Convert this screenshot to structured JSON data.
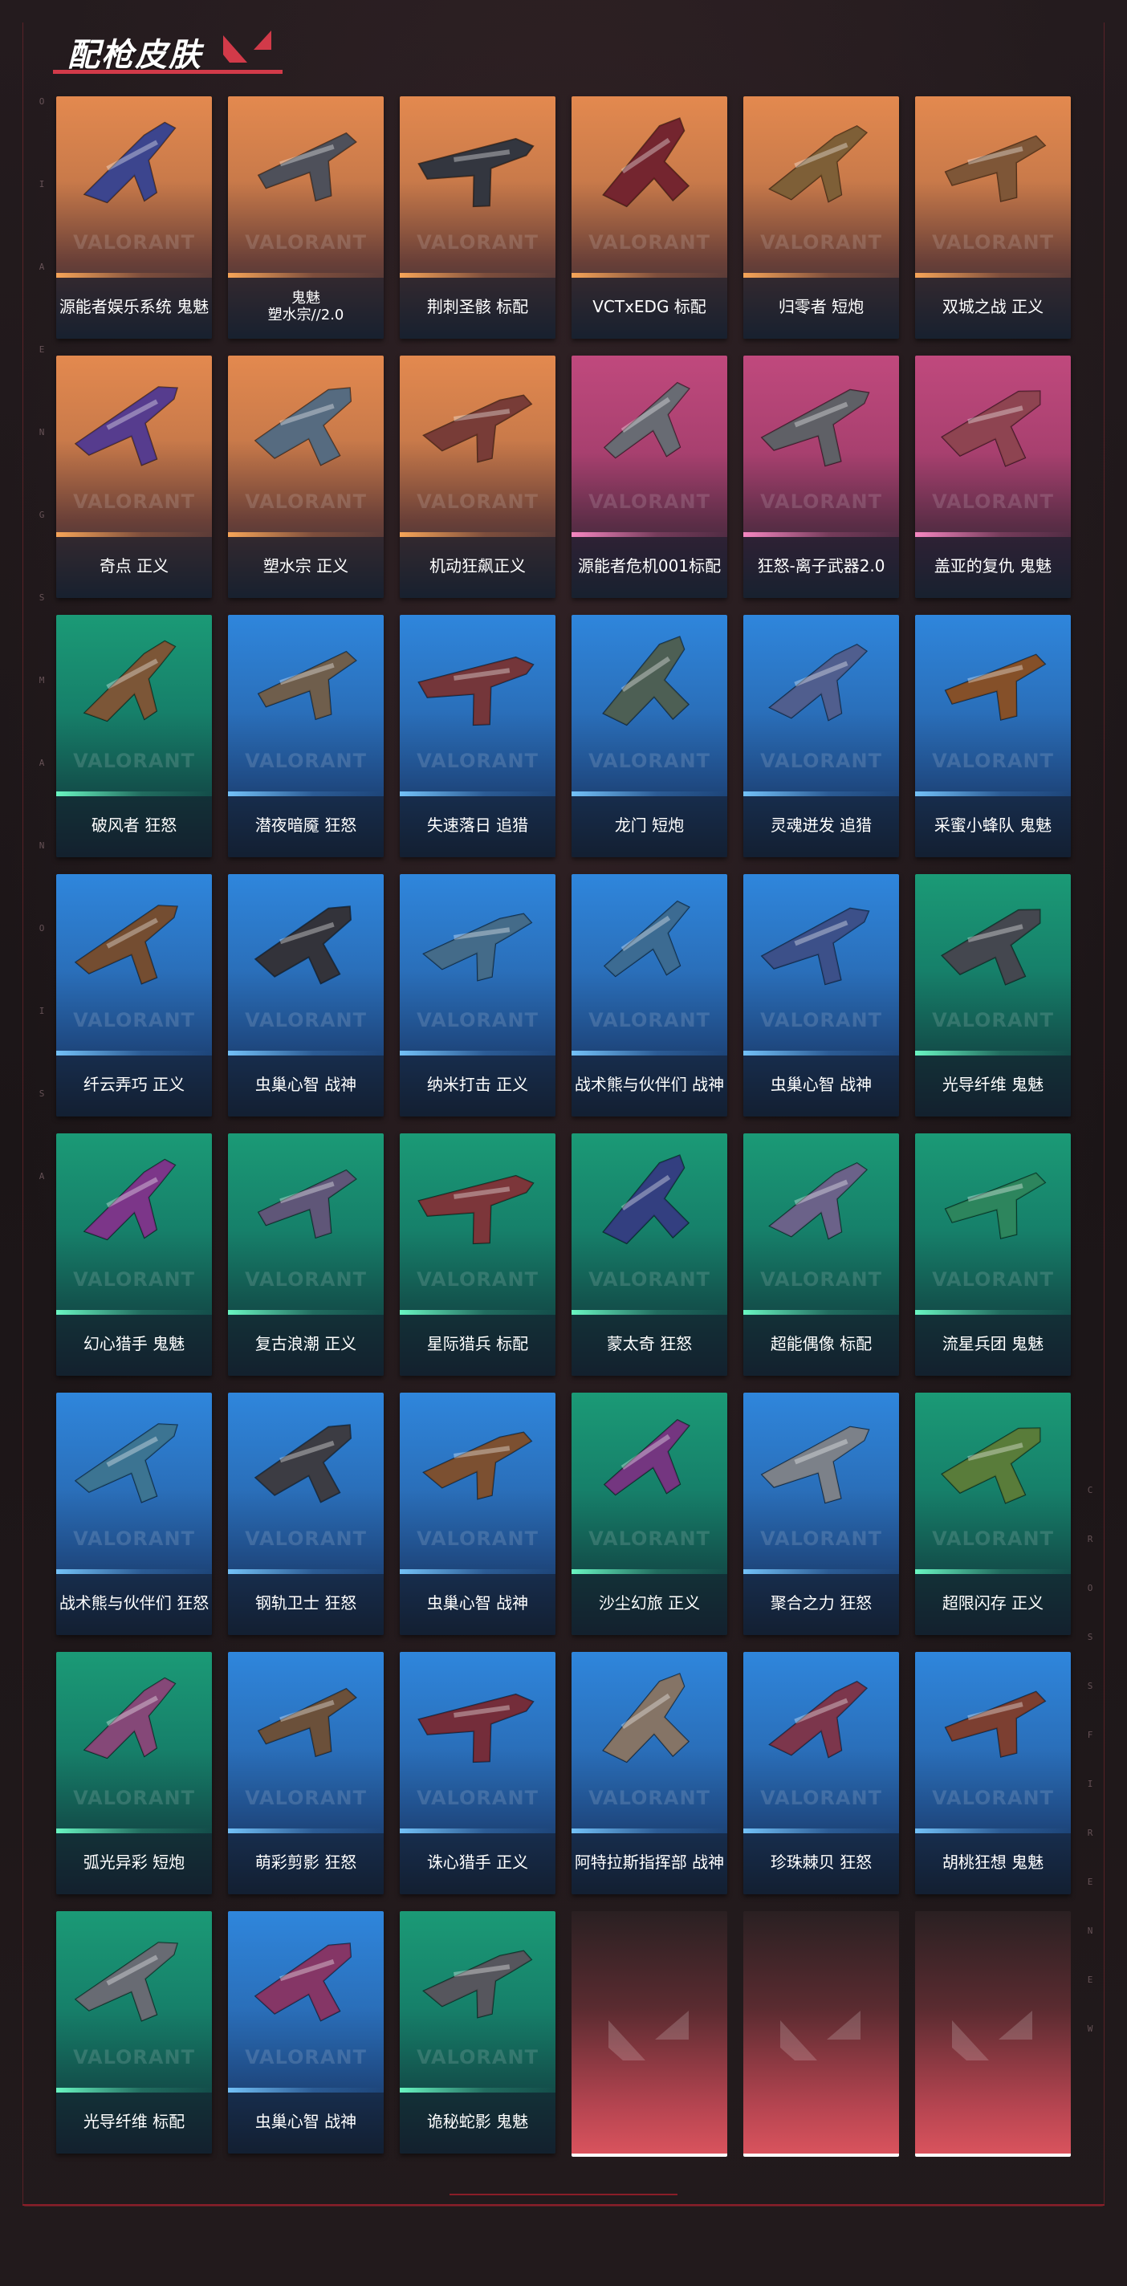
{
  "page": {
    "title": "配枪皮肤",
    "watermark": "VALORANT",
    "side_letters_left": [
      "O",
      "I",
      "A",
      "E",
      "N",
      "G",
      "S",
      "M",
      "A",
      "N",
      "O",
      "I",
      "S",
      "A"
    ],
    "side_letters_right": [
      "C",
      "R",
      "O",
      "S",
      "S",
      "F",
      "I",
      "R",
      "E",
      "N",
      "E",
      "W"
    ]
  },
  "cards": [
    {
      "label": "源能者娱乐系统 鬼魅",
      "theme": "orange",
      "icon": "pistol-skin-icon"
    },
    {
      "label": "鬼魅\n塑水宗//2.0",
      "theme": "orange",
      "icon": "pistol-skin-icon"
    },
    {
      "label": "荆刺圣骸 标配",
      "theme": "orange",
      "icon": "pistol-skin-icon"
    },
    {
      "label": "VCTxEDG 标配",
      "theme": "orange",
      "icon": "pistol-skin-icon"
    },
    {
      "label": "归零者 短炮",
      "theme": "orange",
      "icon": "pistol-skin-icon"
    },
    {
      "label": "双城之战 正义",
      "theme": "orange",
      "icon": "pistol-skin-icon"
    },
    {
      "label": "奇点 正义",
      "theme": "orange",
      "icon": "pistol-skin-icon"
    },
    {
      "label": "塑水宗 正义",
      "theme": "orange",
      "icon": "pistol-skin-icon"
    },
    {
      "label": "机动狂飙正义",
      "theme": "orange",
      "icon": "pistol-skin-icon"
    },
    {
      "label": "源能者危机001标配",
      "theme": "pink",
      "icon": "pistol-skin-icon"
    },
    {
      "label": "狂怒-离子武器2.0",
      "theme": "pink",
      "icon": "pistol-skin-icon"
    },
    {
      "label": "盖亚的复仇 鬼魅",
      "theme": "pink",
      "icon": "pistol-skin-icon"
    },
    {
      "label": "破风者 狂怒",
      "theme": "green",
      "icon": "pistol-skin-icon"
    },
    {
      "label": "潜夜暗魇 狂怒",
      "theme": "blue",
      "icon": "pistol-skin-icon"
    },
    {
      "label": "失速落日 追猎",
      "theme": "blue",
      "icon": "pistol-skin-icon"
    },
    {
      "label": "龙门 短炮",
      "theme": "blue",
      "icon": "pistol-skin-icon"
    },
    {
      "label": "灵魂迸发 追猎",
      "theme": "blue",
      "icon": "pistol-skin-icon"
    },
    {
      "label": "采蜜小蜂队 鬼魅",
      "theme": "blue",
      "icon": "pistol-skin-icon"
    },
    {
      "label": "纤云弄巧 正义",
      "theme": "blue",
      "icon": "pistol-skin-icon"
    },
    {
      "label": "虫巢心智 战神",
      "theme": "blue",
      "icon": "pistol-skin-icon"
    },
    {
      "label": "纳米打击 正义",
      "theme": "blue",
      "icon": "pistol-skin-icon"
    },
    {
      "label": "战术熊与伙伴们 战神",
      "theme": "blue",
      "icon": "pistol-skin-icon"
    },
    {
      "label": "虫巢心智 战神",
      "theme": "blue",
      "icon": "pistol-skin-icon"
    },
    {
      "label": "光导纤维 鬼魅",
      "theme": "green",
      "icon": "pistol-skin-icon"
    },
    {
      "label": "幻心猎手 鬼魅",
      "theme": "green",
      "icon": "pistol-skin-icon"
    },
    {
      "label": "复古浪潮 正义",
      "theme": "green",
      "icon": "pistol-skin-icon"
    },
    {
      "label": "星际猎兵 标配",
      "theme": "green",
      "icon": "pistol-skin-icon"
    },
    {
      "label": "蒙太奇 狂怒",
      "theme": "green",
      "icon": "pistol-skin-icon"
    },
    {
      "label": "超能偶像 标配",
      "theme": "green",
      "icon": "pistol-skin-icon"
    },
    {
      "label": "流星兵团 鬼魅",
      "theme": "green",
      "icon": "pistol-skin-icon"
    },
    {
      "label": "战术熊与伙伴们 狂怒",
      "theme": "blue",
      "icon": "pistol-skin-icon"
    },
    {
      "label": "钢轨卫士 狂怒",
      "theme": "blue",
      "icon": "pistol-skin-icon"
    },
    {
      "label": "虫巢心智 战神",
      "theme": "blue",
      "icon": "pistol-skin-icon"
    },
    {
      "label": "沙尘幻旅 正义",
      "theme": "green",
      "icon": "pistol-skin-icon"
    },
    {
      "label": "聚合之力 狂怒",
      "theme": "blue",
      "icon": "pistol-skin-icon"
    },
    {
      "label": "超限闪存 正义",
      "theme": "green",
      "icon": "pistol-skin-icon"
    },
    {
      "label": "弧光异彩 短炮",
      "theme": "green",
      "icon": "pistol-skin-icon"
    },
    {
      "label": "萌彩剪影 狂怒",
      "theme": "blue",
      "icon": "pistol-skin-icon"
    },
    {
      "label": "诛心猎手 正义",
      "theme": "blue",
      "icon": "pistol-skin-icon"
    },
    {
      "label": "阿特拉斯指挥部 战神",
      "theme": "blue",
      "icon": "pistol-skin-icon"
    },
    {
      "label": "珍珠棘贝 狂怒",
      "theme": "blue",
      "icon": "pistol-skin-icon"
    },
    {
      "label": "胡桃狂想 鬼魅",
      "theme": "blue",
      "icon": "pistol-skin-icon"
    },
    {
      "label": "光导纤维 标配",
      "theme": "green",
      "icon": "pistol-skin-icon"
    },
    {
      "label": "虫巢心智 战神",
      "theme": "blue",
      "icon": "pistol-skin-icon"
    },
    {
      "label": "诡秘蛇影 鬼魅",
      "theme": "green",
      "icon": "pistol-skin-icon"
    },
    {
      "label": "",
      "theme": "empty",
      "icon": "valorant-logo-icon"
    },
    {
      "label": "",
      "theme": "empty",
      "icon": "valorant-logo-icon"
    },
    {
      "label": "",
      "theme": "empty",
      "icon": "valorant-logo-icon"
    }
  ],
  "colors": {
    "orange": "#e3894f",
    "pink": "#c0497d",
    "green": "#1b9a76",
    "blue": "#2f86dc",
    "accent": "#d23a49"
  },
  "gun_accents": [
    "#4a5bd8",
    "#6b6f7a",
    "#3b3f48",
    "#b0202c",
    "#c28a3a",
    "#c27a3a",
    "#7a4ad8",
    "#7aa0c0",
    "#b84a3a",
    "#9aa0a8",
    "#8a8c90",
    "#e05a6a",
    "#c07a3a",
    "#a88860",
    "#b04040",
    "#6a8a70",
    "#7088d8",
    "#d07020",
    "#b06a30",
    "#3a3a40",
    "#5aa0d0",
    "#4aa0e0",
    "#4a70d0",
    "#5a5f66",
    "#c040d0",
    "#8a7ab0",
    "#c04040",
    "#3a50c0",
    "#a090d0",
    "#30d080",
    "#4ab0e0",
    "#4a4a50",
    "#c07030",
    "#b040c0",
    "#c0c8d0",
    "#80c040",
    "#d060b0",
    "#a07040",
    "#b03040",
    "#d0b090",
    "#c04060",
    "#c05030",
    "#9aa0a8",
    "#d04090",
    "#7a7a80",
    "#000",
    "#000",
    "#000"
  ]
}
